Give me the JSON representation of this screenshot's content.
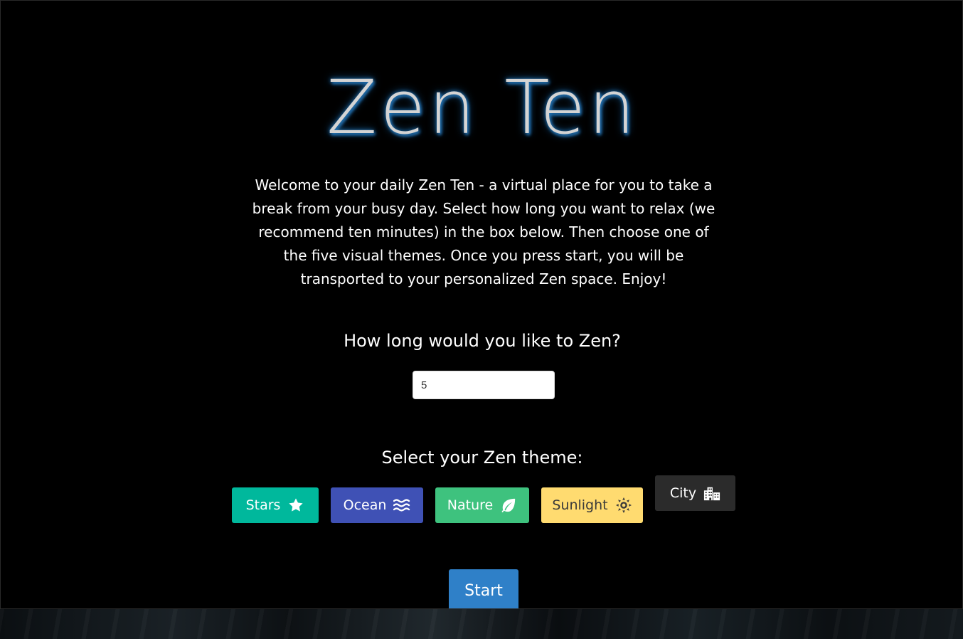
{
  "header": {
    "title": "Zen Ten"
  },
  "intro": {
    "text": "Welcome to your daily Zen Ten - a virtual place for you to take a break from your busy day. Select how long you want to relax (we recommend ten minutes) in the box below. Then choose one of the five visual themes. Once you press start, you will be transported to your personalized Zen space. Enjoy!"
  },
  "duration": {
    "question": "How long would you like to Zen?",
    "value": "5"
  },
  "themes": {
    "heading": "Select your Zen theme:",
    "items": [
      {
        "label": "Stars",
        "icon": "star-icon",
        "color": "#00b89c"
      },
      {
        "label": "Ocean",
        "icon": "water-icon",
        "color": "#3f51b5"
      },
      {
        "label": "Nature",
        "icon": "leaf-icon",
        "color": "#3ec27e"
      },
      {
        "label": "Sunlight",
        "icon": "sun-icon",
        "color": "#ffdb70"
      },
      {
        "label": "City",
        "icon": "city-icon",
        "color": "#2b2b2b"
      }
    ]
  },
  "start": {
    "label": "Start",
    "color": "#2f80c8"
  }
}
